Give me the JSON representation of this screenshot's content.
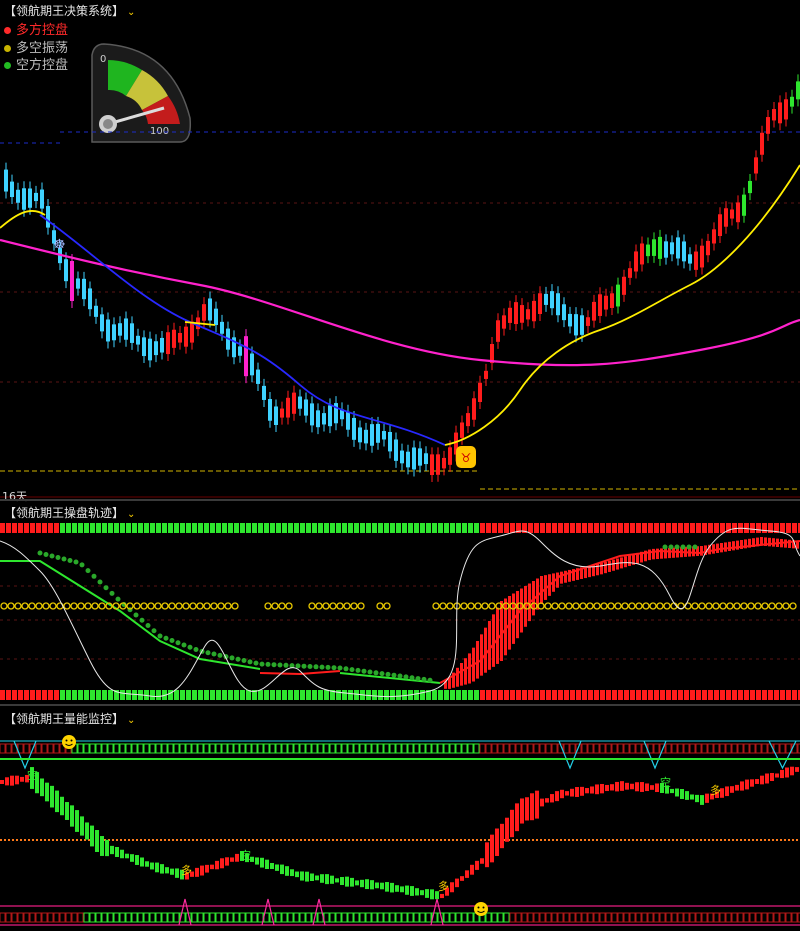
{
  "panel1": {
    "title": "【领航期王决策系统】",
    "legend": [
      {
        "label": "多方控盘",
        "color": "#ff2a2a"
      },
      {
        "label": "多空振荡",
        "color": "#c8b400"
      },
      {
        "label": "空方控盘",
        "color": "#22bb22"
      }
    ],
    "gauge": {
      "min_label": "0",
      "max_label": "100"
    },
    "day_label": "16天"
  },
  "panel2": {
    "title": "【领航期王操盘轨迹】"
  },
  "panel3": {
    "title": "【领航期王量能监控】",
    "markers": {
      "kong": "空",
      "duo": "多"
    }
  },
  "colors": {
    "bull": "#ff1c1c",
    "bear": "#3fd2ff",
    "green": "#2ee62e",
    "magenta": "#ff22cc",
    "yellow": "#ffee00",
    "blue": "#2828ff",
    "cyan": "#22d0e8"
  },
  "icons": [
    "chevron-down-icon",
    "gauge-icon",
    "bull-badge-icon",
    "smiley-icon"
  ]
}
